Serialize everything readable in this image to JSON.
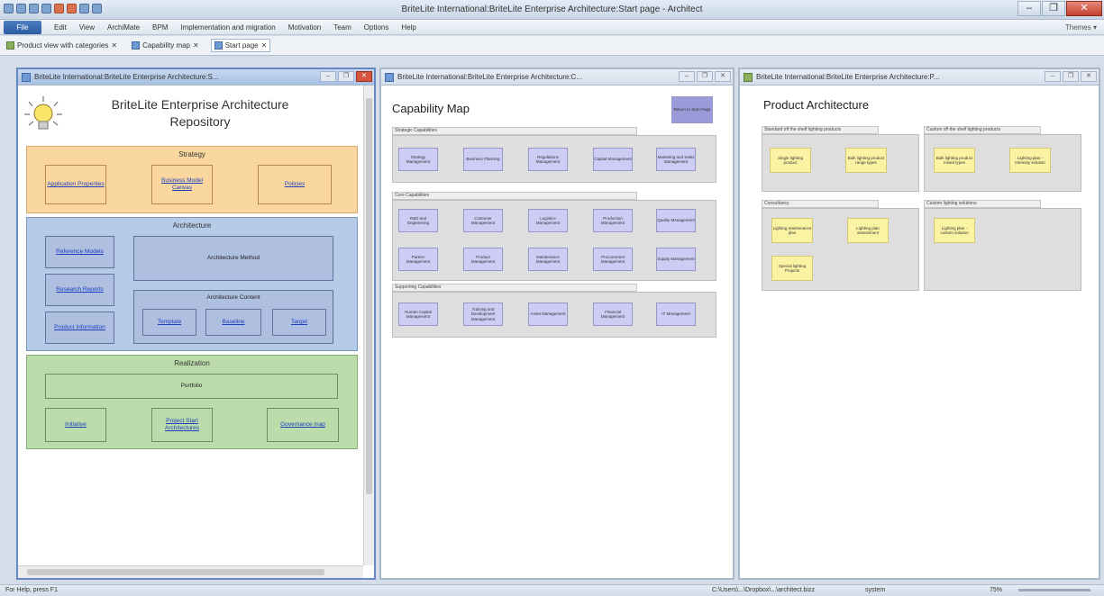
{
  "window": {
    "title": "BriteLite International:BriteLite Enterprise Architecture:Start page - Architect",
    "min": "–",
    "max": "❐",
    "close": "✕"
  },
  "menu": {
    "file": "File",
    "items": [
      "Edit",
      "View",
      "ArchiMate",
      "BPM",
      "Implementation and migration",
      "Motivation",
      "Team",
      "Options",
      "Help"
    ],
    "themes": "Themes ▾"
  },
  "tabs": [
    {
      "label": "Product view with categories"
    },
    {
      "label": "Capability map"
    },
    {
      "label": "Start page"
    }
  ],
  "tab_close": "✕",
  "panes": {
    "left": {
      "title": "BriteLite International:BriteLite Enterprise Architecture:S...",
      "heading_line1": "BriteLite Enterprise Architecture",
      "heading_line2": "Repository",
      "strategy": {
        "label": "Strategy",
        "boxes": [
          "Application Properties",
          "Business Model Canvas",
          "Policies"
        ]
      },
      "architecture": {
        "label": "Architecture",
        "side": [
          "Reference Models",
          "Research Reports",
          "Product Information"
        ],
        "method": "Architecture Method",
        "content_label": "Architecture Content",
        "content": [
          "Template",
          "Baseline",
          "Target"
        ]
      },
      "realization": {
        "label": "Realization",
        "portfolio": "Portfolio",
        "items": [
          "Initiative",
          "Project Start Architectures",
          "Governance map"
        ]
      }
    },
    "middle": {
      "title": "BriteLite International:BriteLite Enterprise Architecture:C...",
      "heading": "Capability Map",
      "corner_box": "Return to Start Page",
      "groups": [
        {
          "label": "Strategic Capabilities",
          "rows": [
            [
              "Strategy Management",
              "Business Planning",
              "Regulations Management",
              "Capital Management",
              "Marketing and Sales Management"
            ]
          ]
        },
        {
          "label": "Core Capabilities",
          "rows": [
            [
              "R&D and Engineering",
              "Customer Management",
              "Logistics Management",
              "Production Management",
              "Quality Management"
            ],
            [
              "Partner Management",
              "Product Management",
              "Maintenance Management",
              "Procurement Management",
              "Supply Management"
            ]
          ]
        },
        {
          "label": "Supporting Capabilities",
          "rows": [
            [
              "Human Capital Management",
              "Training and Development Management",
              "Asset Management",
              "Financial Management",
              "IT Management"
            ]
          ]
        }
      ]
    },
    "right": {
      "title": "BriteLite International:BriteLite Enterprise Architecture:P...",
      "heading": "Product Architecture",
      "groups": [
        {
          "label": "Standard off the shelf lighting products",
          "items": [
            "Single lighting product",
            "Bulk lighting product range types"
          ]
        },
        {
          "label": "Custom off the shelf lighting products",
          "items": [
            "Bulk lighting product mixed types",
            "Lighting plan - Intensity solution"
          ]
        },
        {
          "label": "Consultancy",
          "items": [
            "Lighting maintenance plan",
            "Lighting plan assessment",
            "Special lighting Projects"
          ]
        },
        {
          "label": "Custom lighting solutions",
          "items": [
            "Lighting plan - custom solution"
          ]
        }
      ],
      "ctl": [
        "–",
        "❐",
        "✕"
      ]
    }
  },
  "status": {
    "left": "For Help, press F1",
    "path": "C:\\Users\\...\\Dropbox\\...\\architect.bizz",
    "user": "system",
    "zoom": "75%"
  },
  "colors": {
    "strategy": "#fbd7a0",
    "architecture": "#b6cbe8",
    "realization": "#bcdcab",
    "capability": "#ccccf4",
    "product": "#fbf3a4"
  }
}
